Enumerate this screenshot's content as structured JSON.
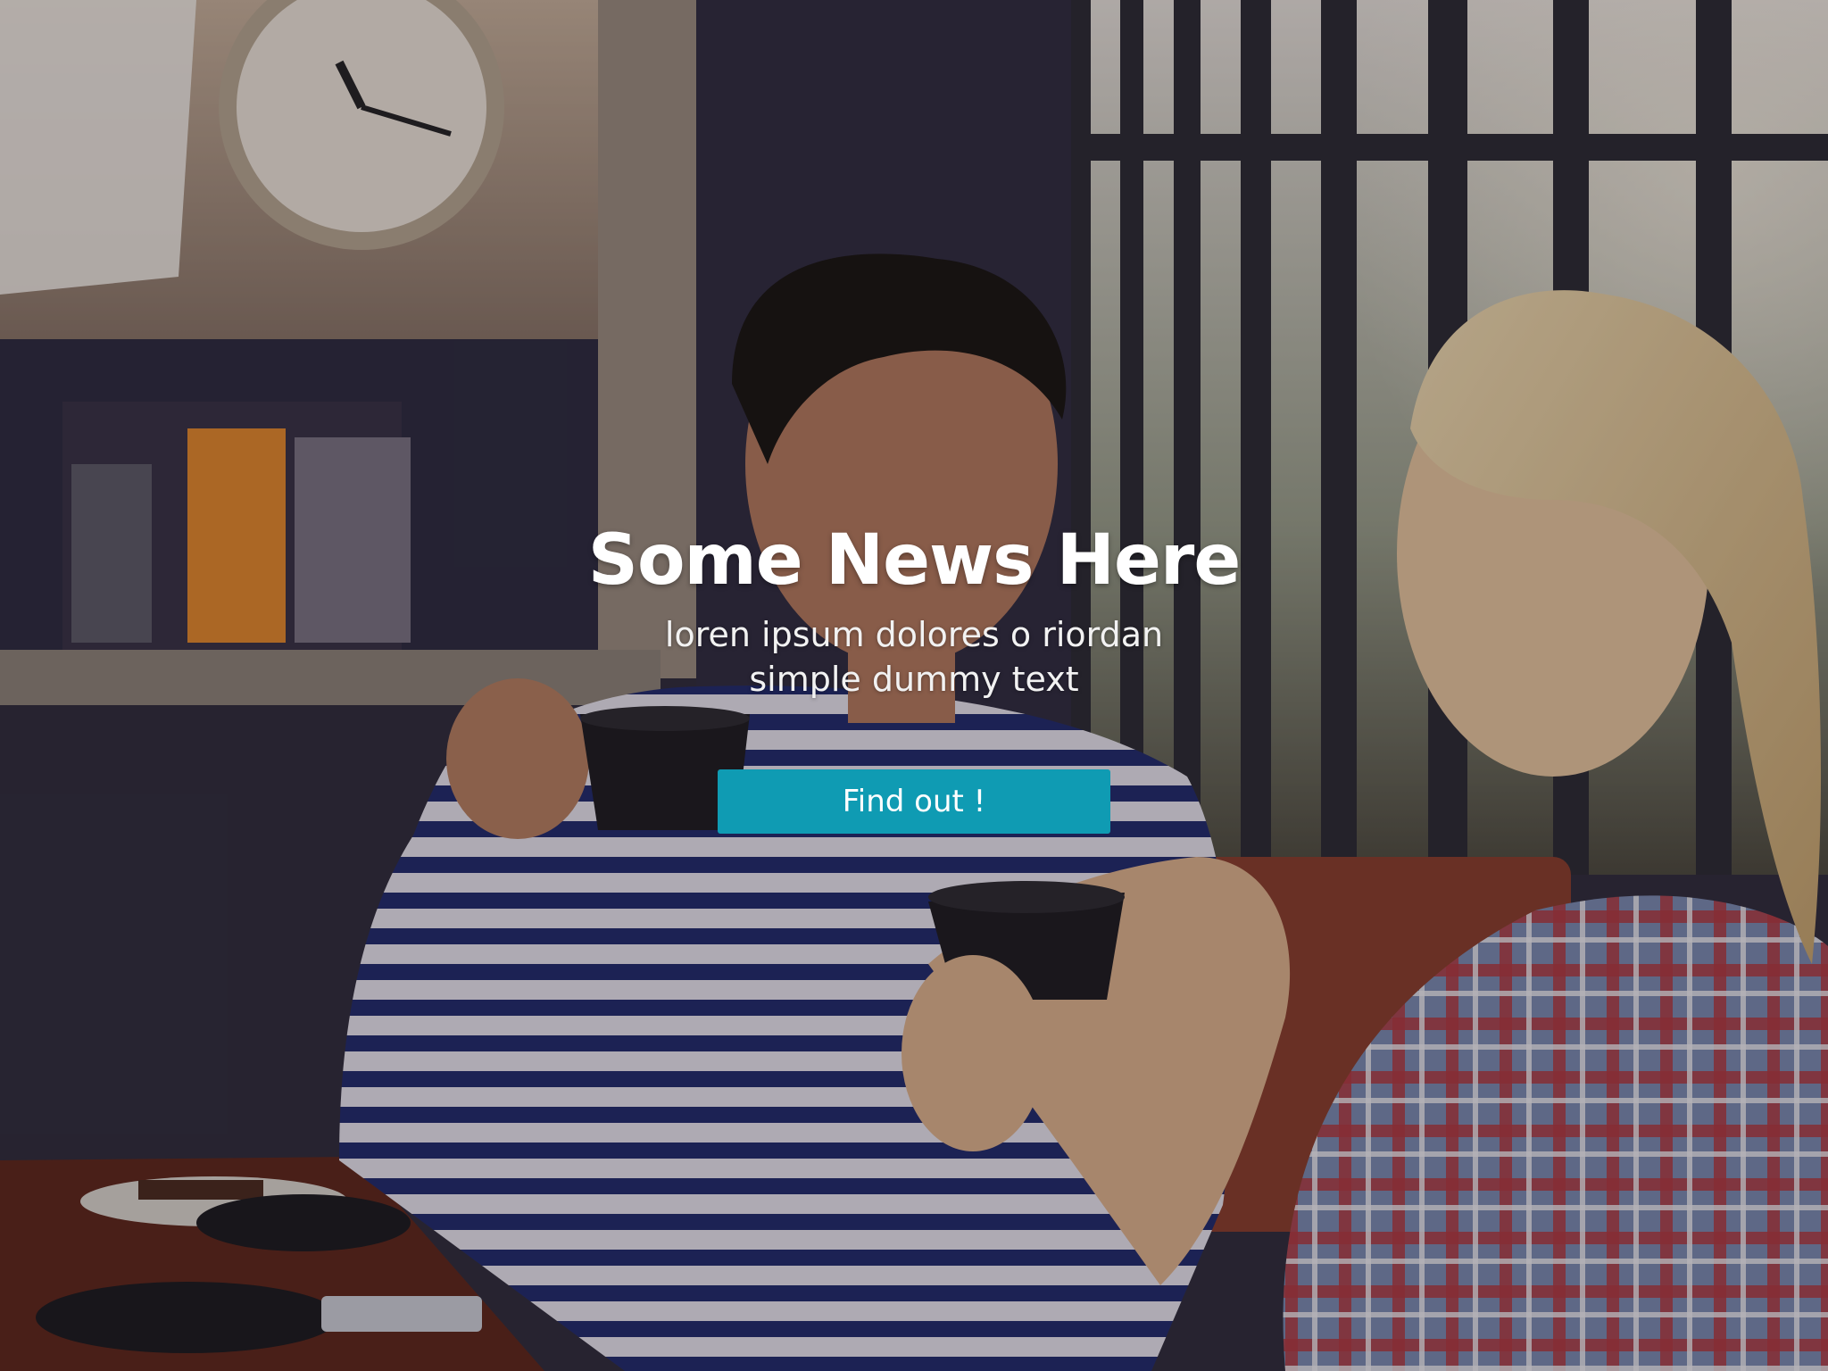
{
  "hero": {
    "headline": "Some News Here",
    "subtext_line1": "loren ipsum dolores o riordan",
    "subtext_line2": "simple dummy text",
    "cta_label": "Find out !",
    "background_image": "two women toasting coffee cups in a cafe"
  },
  "colors": {
    "cta_background": "#0f9bb3",
    "text": "#ffffff"
  }
}
